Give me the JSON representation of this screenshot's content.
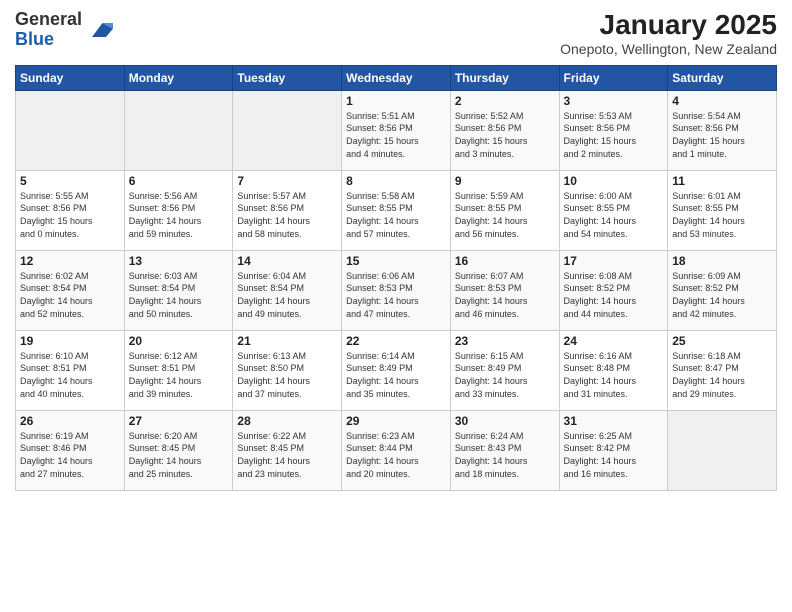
{
  "header": {
    "logo_general": "General",
    "logo_blue": "Blue",
    "title": "January 2025",
    "subtitle": "Onepoto, Wellington, New Zealand"
  },
  "days_of_week": [
    "Sunday",
    "Monday",
    "Tuesday",
    "Wednesday",
    "Thursday",
    "Friday",
    "Saturday"
  ],
  "weeks": [
    [
      {
        "num": "",
        "info": ""
      },
      {
        "num": "",
        "info": ""
      },
      {
        "num": "",
        "info": ""
      },
      {
        "num": "1",
        "info": "Sunrise: 5:51 AM\nSunset: 8:56 PM\nDaylight: 15 hours\nand 4 minutes."
      },
      {
        "num": "2",
        "info": "Sunrise: 5:52 AM\nSunset: 8:56 PM\nDaylight: 15 hours\nand 3 minutes."
      },
      {
        "num": "3",
        "info": "Sunrise: 5:53 AM\nSunset: 8:56 PM\nDaylight: 15 hours\nand 2 minutes."
      },
      {
        "num": "4",
        "info": "Sunrise: 5:54 AM\nSunset: 8:56 PM\nDaylight: 15 hours\nand 1 minute."
      }
    ],
    [
      {
        "num": "5",
        "info": "Sunrise: 5:55 AM\nSunset: 8:56 PM\nDaylight: 15 hours\nand 0 minutes."
      },
      {
        "num": "6",
        "info": "Sunrise: 5:56 AM\nSunset: 8:56 PM\nDaylight: 14 hours\nand 59 minutes."
      },
      {
        "num": "7",
        "info": "Sunrise: 5:57 AM\nSunset: 8:56 PM\nDaylight: 14 hours\nand 58 minutes."
      },
      {
        "num": "8",
        "info": "Sunrise: 5:58 AM\nSunset: 8:55 PM\nDaylight: 14 hours\nand 57 minutes."
      },
      {
        "num": "9",
        "info": "Sunrise: 5:59 AM\nSunset: 8:55 PM\nDaylight: 14 hours\nand 56 minutes."
      },
      {
        "num": "10",
        "info": "Sunrise: 6:00 AM\nSunset: 8:55 PM\nDaylight: 14 hours\nand 54 minutes."
      },
      {
        "num": "11",
        "info": "Sunrise: 6:01 AM\nSunset: 8:55 PM\nDaylight: 14 hours\nand 53 minutes."
      }
    ],
    [
      {
        "num": "12",
        "info": "Sunrise: 6:02 AM\nSunset: 8:54 PM\nDaylight: 14 hours\nand 52 minutes."
      },
      {
        "num": "13",
        "info": "Sunrise: 6:03 AM\nSunset: 8:54 PM\nDaylight: 14 hours\nand 50 minutes."
      },
      {
        "num": "14",
        "info": "Sunrise: 6:04 AM\nSunset: 8:54 PM\nDaylight: 14 hours\nand 49 minutes."
      },
      {
        "num": "15",
        "info": "Sunrise: 6:06 AM\nSunset: 8:53 PM\nDaylight: 14 hours\nand 47 minutes."
      },
      {
        "num": "16",
        "info": "Sunrise: 6:07 AM\nSunset: 8:53 PM\nDaylight: 14 hours\nand 46 minutes."
      },
      {
        "num": "17",
        "info": "Sunrise: 6:08 AM\nSunset: 8:52 PM\nDaylight: 14 hours\nand 44 minutes."
      },
      {
        "num": "18",
        "info": "Sunrise: 6:09 AM\nSunset: 8:52 PM\nDaylight: 14 hours\nand 42 minutes."
      }
    ],
    [
      {
        "num": "19",
        "info": "Sunrise: 6:10 AM\nSunset: 8:51 PM\nDaylight: 14 hours\nand 40 minutes."
      },
      {
        "num": "20",
        "info": "Sunrise: 6:12 AM\nSunset: 8:51 PM\nDaylight: 14 hours\nand 39 minutes."
      },
      {
        "num": "21",
        "info": "Sunrise: 6:13 AM\nSunset: 8:50 PM\nDaylight: 14 hours\nand 37 minutes."
      },
      {
        "num": "22",
        "info": "Sunrise: 6:14 AM\nSunset: 8:49 PM\nDaylight: 14 hours\nand 35 minutes."
      },
      {
        "num": "23",
        "info": "Sunrise: 6:15 AM\nSunset: 8:49 PM\nDaylight: 14 hours\nand 33 minutes."
      },
      {
        "num": "24",
        "info": "Sunrise: 6:16 AM\nSunset: 8:48 PM\nDaylight: 14 hours\nand 31 minutes."
      },
      {
        "num": "25",
        "info": "Sunrise: 6:18 AM\nSunset: 8:47 PM\nDaylight: 14 hours\nand 29 minutes."
      }
    ],
    [
      {
        "num": "26",
        "info": "Sunrise: 6:19 AM\nSunset: 8:46 PM\nDaylight: 14 hours\nand 27 minutes."
      },
      {
        "num": "27",
        "info": "Sunrise: 6:20 AM\nSunset: 8:45 PM\nDaylight: 14 hours\nand 25 minutes."
      },
      {
        "num": "28",
        "info": "Sunrise: 6:22 AM\nSunset: 8:45 PM\nDaylight: 14 hours\nand 23 minutes."
      },
      {
        "num": "29",
        "info": "Sunrise: 6:23 AM\nSunset: 8:44 PM\nDaylight: 14 hours\nand 20 minutes."
      },
      {
        "num": "30",
        "info": "Sunrise: 6:24 AM\nSunset: 8:43 PM\nDaylight: 14 hours\nand 18 minutes."
      },
      {
        "num": "31",
        "info": "Sunrise: 6:25 AM\nSunset: 8:42 PM\nDaylight: 14 hours\nand 16 minutes."
      },
      {
        "num": "",
        "info": ""
      }
    ]
  ]
}
